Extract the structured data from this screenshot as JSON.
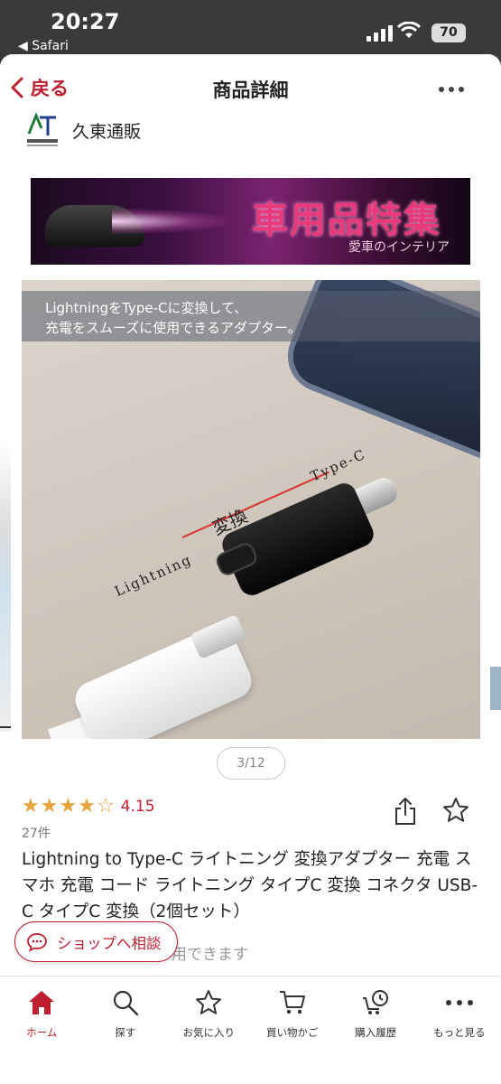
{
  "status_bar": {
    "time": "20:27",
    "back_app": "◀ Safari",
    "battery": "70"
  },
  "navbar": {
    "back_label": "戻る",
    "title": "商品詳細"
  },
  "shop": {
    "name": "久東通販"
  },
  "banner": {
    "title": "車用品特集",
    "subtitle": "愛車のインテリア"
  },
  "product_image": {
    "caption_line1": "LightningをType-Cに変換して、",
    "caption_line2": "充電をスムーズに使用できるアダプター。",
    "label_lightning": "Lightning",
    "label_typec": "Type-C",
    "label_henkan": "変換"
  },
  "pager": "3/12",
  "rating": {
    "value": "4.15",
    "stars": 4,
    "count": "27件"
  },
  "product": {
    "title": "Lightning to Type-C ライトニング 変換アダプター 充電 スマホ 充電 コード ライトニング タイプC 変換 コネクタ USB-C タイプC 変換（2個セット）",
    "partial_text": "用できます"
  },
  "consult_button": "ショップへ相談",
  "tabs": [
    {
      "label": "ホーム",
      "icon": "home-icon",
      "active": true
    },
    {
      "label": "探す",
      "icon": "search-icon",
      "active": false
    },
    {
      "label": "お気に入り",
      "icon": "star-icon",
      "active": false
    },
    {
      "label": "買い物かご",
      "icon": "cart-icon",
      "active": false
    },
    {
      "label": "購入履歴",
      "icon": "history-icon",
      "active": false
    },
    {
      "label": "もっと見る",
      "icon": "more-icon",
      "active": false
    }
  ],
  "colors": {
    "accent": "#bf1e2e",
    "star": "#e8a33a"
  }
}
